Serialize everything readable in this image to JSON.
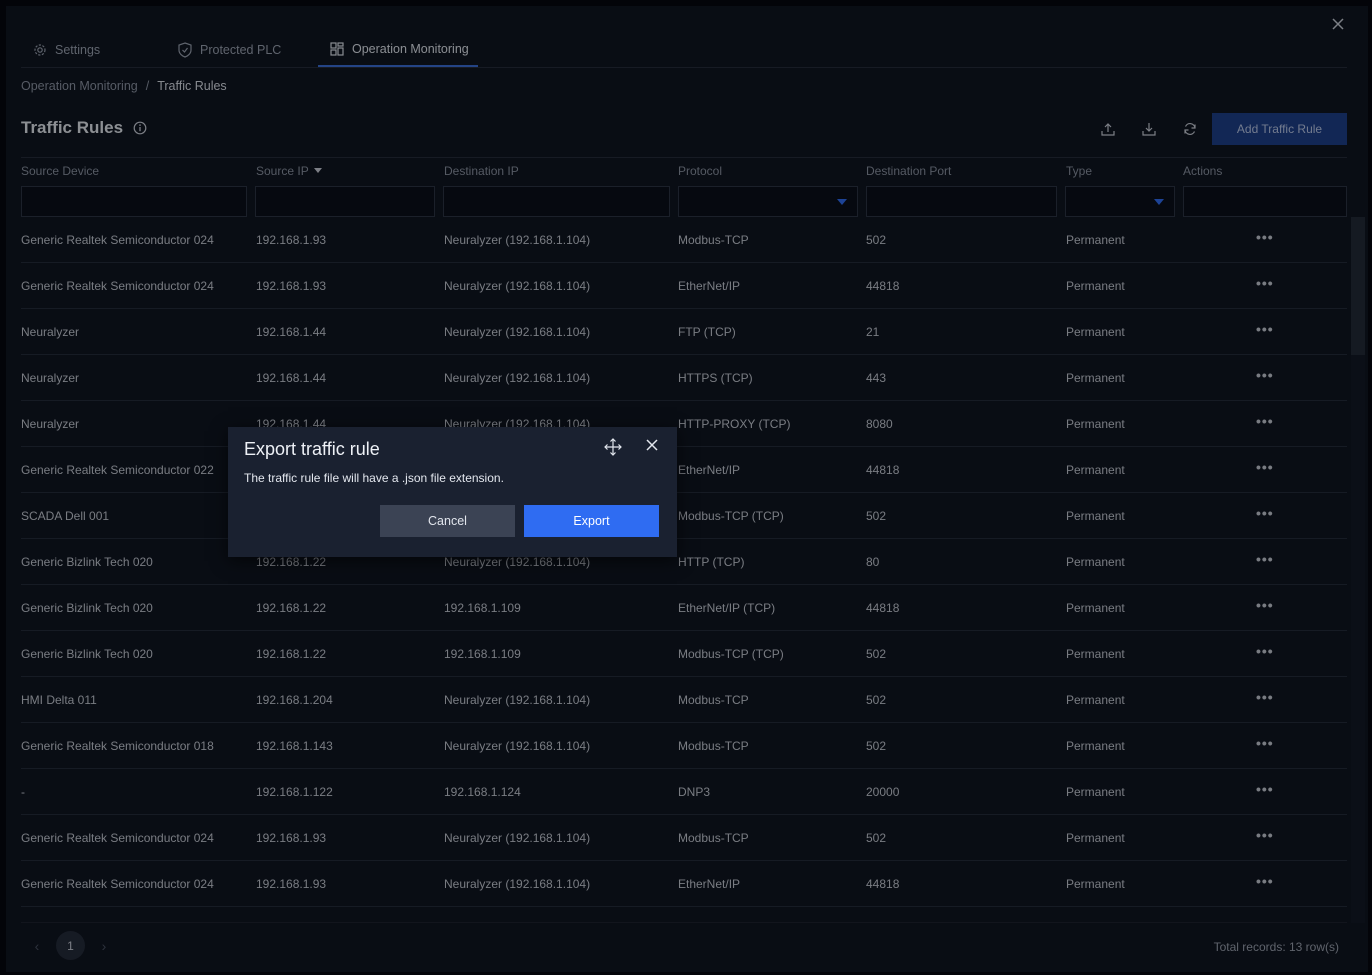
{
  "tabs": [
    {
      "label": "Settings",
      "icon": "gear-icon"
    },
    {
      "label": "Protected PLC",
      "icon": "shield-icon"
    },
    {
      "label": "Operation Monitoring",
      "icon": "grid-icon"
    }
  ],
  "breadcrumb": {
    "parent": "Operation Monitoring",
    "separator": "/",
    "current": "Traffic Rules"
  },
  "page": {
    "title": "Traffic Rules",
    "add_button": "Add Traffic Rule"
  },
  "toolbar": {
    "icons": [
      "upload-icon",
      "download-icon",
      "refresh-icon"
    ]
  },
  "table": {
    "columns": [
      "Source Device",
      "Source IP",
      "Destination IP",
      "Protocol",
      "Destination Port",
      "Type",
      "Actions"
    ],
    "sort_column": "Source IP",
    "rows": [
      [
        "Generic Realtek Semiconductor 024",
        "192.168.1.93",
        "Neuralyzer (192.168.1.104)",
        "Modbus-TCP",
        "502",
        "Permanent"
      ],
      [
        "Generic Realtek Semiconductor 024",
        "192.168.1.93",
        "Neuralyzer (192.168.1.104)",
        "EtherNet/IP",
        "44818",
        "Permanent"
      ],
      [
        "Neuralyzer",
        "192.168.1.44",
        "Neuralyzer (192.168.1.104)",
        "FTP (TCP)",
        "21",
        "Permanent"
      ],
      [
        "Neuralyzer",
        "192.168.1.44",
        "Neuralyzer (192.168.1.104)",
        "HTTPS (TCP)",
        "443",
        "Permanent"
      ],
      [
        "Neuralyzer",
        "192.168.1.44",
        "Neuralyzer (192.168.1.104)",
        "HTTP-PROXY (TCP)",
        "8080",
        "Permanent"
      ],
      [
        "Generic Realtek Semiconductor 022",
        "",
        "",
        "EtherNet/IP",
        "44818",
        "Permanent"
      ],
      [
        "SCADA Dell 001",
        "",
        "",
        "Modbus-TCP (TCP)",
        "502",
        "Permanent"
      ],
      [
        "Generic Bizlink Tech 020",
        "192.168.1.22",
        "Neuralyzer (192.168.1.104)",
        "HTTP (TCP)",
        "80",
        "Permanent"
      ],
      [
        "Generic Bizlink Tech 020",
        "192.168.1.22",
        "192.168.1.109",
        "EtherNet/IP (TCP)",
        "44818",
        "Permanent"
      ],
      [
        "Generic Bizlink Tech 020",
        "192.168.1.22",
        "192.168.1.109",
        "Modbus-TCP (TCP)",
        "502",
        "Permanent"
      ],
      [
        "HMI Delta 011",
        "192.168.1.204",
        "Neuralyzer (192.168.1.104)",
        "Modbus-TCP",
        "502",
        "Permanent"
      ],
      [
        "Generic Realtek Semiconductor 018",
        "192.168.1.143",
        "Neuralyzer (192.168.1.104)",
        "Modbus-TCP",
        "502",
        "Permanent"
      ],
      [
        "-",
        "192.168.1.122",
        "192.168.1.124",
        "DNP3",
        "20000",
        "Permanent"
      ],
      [
        "Generic Realtek Semiconductor 024",
        "192.168.1.93",
        "Neuralyzer (192.168.1.104)",
        "Modbus-TCP",
        "502",
        "Permanent"
      ],
      [
        "Generic Realtek Semiconductor 024",
        "192.168.1.93",
        "Neuralyzer (192.168.1.104)",
        "EtherNet/IP",
        "44818",
        "Permanent"
      ]
    ],
    "row_action": "•••"
  },
  "pagination": {
    "current_page": "1",
    "prev": "‹",
    "next": "›",
    "total": "Total records: 13 row(s)"
  },
  "dialog": {
    "title": "Export traffic rule",
    "message": "The traffic rule file will have a .json file extension.",
    "cancel": "Cancel",
    "export": "Export"
  },
  "colors": {
    "accent": "#2f6cf2",
    "add_button": "#1e3f8a",
    "background": "#0f1521"
  }
}
